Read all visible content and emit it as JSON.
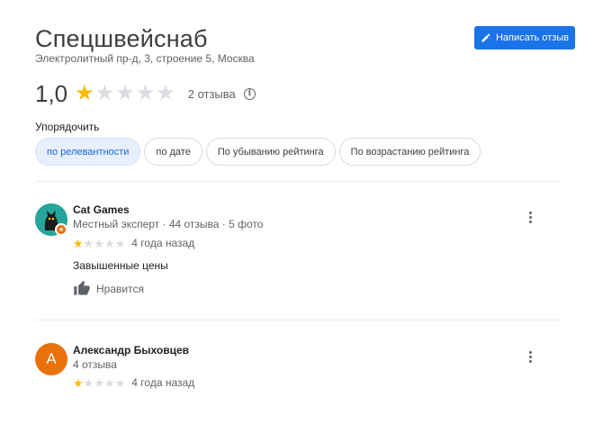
{
  "place": {
    "title": "Спецшвейснаб",
    "address": "Электролитный пр-д, 3, строение 5, Москва"
  },
  "write_review": {
    "label": "Написать отзыв",
    "icon": "pencil-icon"
  },
  "summary": {
    "rating_text": "1,0",
    "rating": 1,
    "max_rating": 5,
    "count_text": "2 отзыва",
    "info_icon": "info-icon"
  },
  "sort": {
    "label": "Упорядочить",
    "options": [
      {
        "label": "по релевантности",
        "active": true
      },
      {
        "label": "по дате",
        "active": false
      },
      {
        "label": "По убыванию рейтинга",
        "active": false
      },
      {
        "label": "По возрастанию рейтинга",
        "active": false
      }
    ]
  },
  "reviews": [
    {
      "author": "Cat Games",
      "meta": "Местный эксперт · 44 отзыва · 5 фото",
      "rating": 1,
      "time": "4 года назад",
      "text": "Завышенные цены",
      "like_label": "Нравится",
      "avatar": "cat-avatar"
    },
    {
      "author": "Александр Быховцев",
      "meta": "4 отзыва",
      "rating": 1,
      "time": "4 года назад",
      "avatar_letter": "А"
    }
  ],
  "colors": {
    "accent": "#1a73e8",
    "star": "#fbbc04",
    "star_empty": "#dadce0",
    "avatar_orange": "#e8710a",
    "avatar_teal": "#26a69a"
  }
}
